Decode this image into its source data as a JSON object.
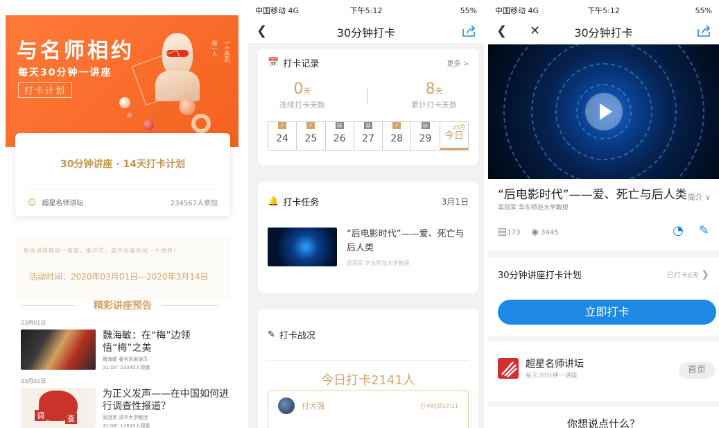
{
  "panel1": {
    "hero": {
      "title": "与名师相约",
      "subtitle": "每天30分钟一讲座",
      "tag": "打卡计划",
      "side_a": "一个西的",
      "side_b": "做一人"
    },
    "card": {
      "title": "30分钟讲座 · 14天打卡计划",
      "host": "超星名师讲坛",
      "count": "234567人参加"
    },
    "motto": "每场讲座都是一扇窗，推开它，或许会看到另一个世界！",
    "activity_time": "活动时间：2020年03月01日—2020年3月14日",
    "preview_title": "精彩讲座预告",
    "lectures": [
      {
        "date": "03月01日",
        "title": "魏海敏：在“梅”边领悟“梅”之美",
        "speaker": "魏海敏 著名京剧演员",
        "meta": "31'35\"  23345人观看"
      },
      {
        "date": "03月02日",
        "title": "为正义发声——在中国如何进行调查性报道？",
        "speaker": "吴冠英 清华大学教授",
        "meta": "31'08\"  17835人观看"
      }
    ],
    "map_text_a": "调",
    "map_text_b": "查"
  },
  "panel2": {
    "status": {
      "carrier": "中国移动 4G",
      "time": "下午5:12",
      "right": "55%"
    },
    "nav_title": "30分钟打卡",
    "record": {
      "title": "打卡记录",
      "more": "更多 >",
      "consecutive_num": "0",
      "consecutive_unit": "天",
      "consecutive_label": "连续打卡天数",
      "total_num": "8",
      "total_unit": "天",
      "total_label": "累计打卡天数",
      "days": [
        {
          "day": "24",
          "mark": "✓"
        },
        {
          "day": "25",
          "mark": "✓"
        },
        {
          "day": "26",
          "mark": "缺"
        },
        {
          "day": "27",
          "mark": "缺"
        },
        {
          "day": "28",
          "mark": "✓"
        },
        {
          "day": "29",
          "mark": "缺"
        },
        {
          "day": "今日",
          "mark": "",
          "month": "03月"
        }
      ]
    },
    "task": {
      "title": "打卡任务",
      "date": "3月1日",
      "item_title": "“后电影时代”——爱、死亡与后人类",
      "item_meta": "吴冠军   华东师范大学教授"
    },
    "battle": {
      "title": "打卡战况",
      "today": "今日打卡2141人",
      "user": "付大强",
      "time": "打卡时间17:11"
    }
  },
  "panel3": {
    "status": {
      "carrier": "中国移动 4G",
      "time": "下午5:12",
      "right": "55%"
    },
    "nav_title": "30分钟打卡",
    "video_title": "“后电影时代”——爱、死亡与后人类",
    "intro": "简介 ∨",
    "author": "吴冠军  华东师范大学教授",
    "comments": "173",
    "views": "3445",
    "plan_title": "30分钟讲座打卡计划",
    "plan_done": "已打卡8天",
    "cta": "立即打卡",
    "brand_name": "超星名师讲坛",
    "brand_sub": "每天30分钟一讲座",
    "home": "首页",
    "ask": "你想说点什么？"
  },
  "colors": {
    "orange": "#f4611f",
    "gold": "#d4a468",
    "blue": "#1e88e5",
    "brand_red": "#d32f2f"
  }
}
